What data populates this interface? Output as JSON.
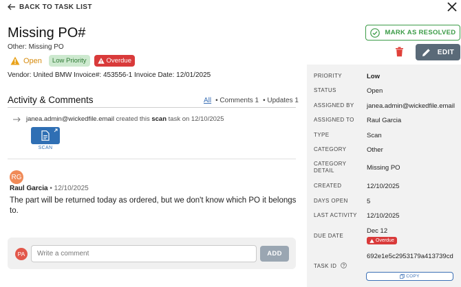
{
  "header": {
    "back_label": "BACK TO TASK LIST",
    "title": "Missing PO#",
    "subtitle": "Other: Missing PO",
    "status": "Open",
    "priority_badge": "Low Priority",
    "overdue_badge": "Overdue",
    "meta_line": "Vendor: United BMW Invoice#: 453556-1 Invoice Date: 12/01/2025"
  },
  "actions": {
    "resolve_label": "MARK AS RESOLVED",
    "edit_label": "EDIT"
  },
  "activity": {
    "title": "Activity & Comments",
    "filter_all": "All",
    "filter_comments": "• Comments 1",
    "filter_updates": "• Updates 1",
    "event": {
      "user": "janea.admin@wickedfile.email",
      "text_created": "created this",
      "doc_type": "scan",
      "text_task": "task",
      "text_on": "on 12/10/2025"
    },
    "attachment_label": "SCAN",
    "comment": {
      "initials": "RG",
      "author": "Raul Garcia",
      "date": "• 12/10/2025",
      "body": "The part will be returned today as ordered, but we don't know which PO it belongs to."
    },
    "composer": {
      "initials": "PA",
      "placeholder": "Write a comment",
      "add_label": "ADD"
    }
  },
  "details": {
    "priority": {
      "label": "PRIORITY",
      "value": "Low"
    },
    "status": {
      "label": "STATUS",
      "value": "Open"
    },
    "assigned_by": {
      "label": "ASSIGNED BY",
      "value": "janea.admin@wickedfile.email"
    },
    "assigned_to": {
      "label": "ASSIGNED TO",
      "value": "Raul Garcia"
    },
    "type": {
      "label": "TYPE",
      "value": "Scan"
    },
    "category": {
      "label": "CATEGORY",
      "value": "Other"
    },
    "category_detail": {
      "label": "CATEGORY DETAIL",
      "value": "Missing PO"
    },
    "created": {
      "label": "CREATED",
      "value": "12/10/2025"
    },
    "days_open": {
      "label": "DAYS OPEN",
      "value": "5"
    },
    "last_activity": {
      "label": "LAST ACTIVITY",
      "value": "12/10/2025"
    },
    "due_date": {
      "label": "DUE DATE",
      "value": "Dec 12",
      "badge": "Overdue"
    },
    "task_id": {
      "label": "TASK ID",
      "value": "692e1e5c2953179a413739cd",
      "copy_label": "COPY"
    }
  },
  "colors": {
    "warning": "#d68a0c",
    "success": "#3a9b46",
    "danger": "#d93a3a",
    "link": "#3a6fb5",
    "scan_tile": "#2f6fb4"
  }
}
